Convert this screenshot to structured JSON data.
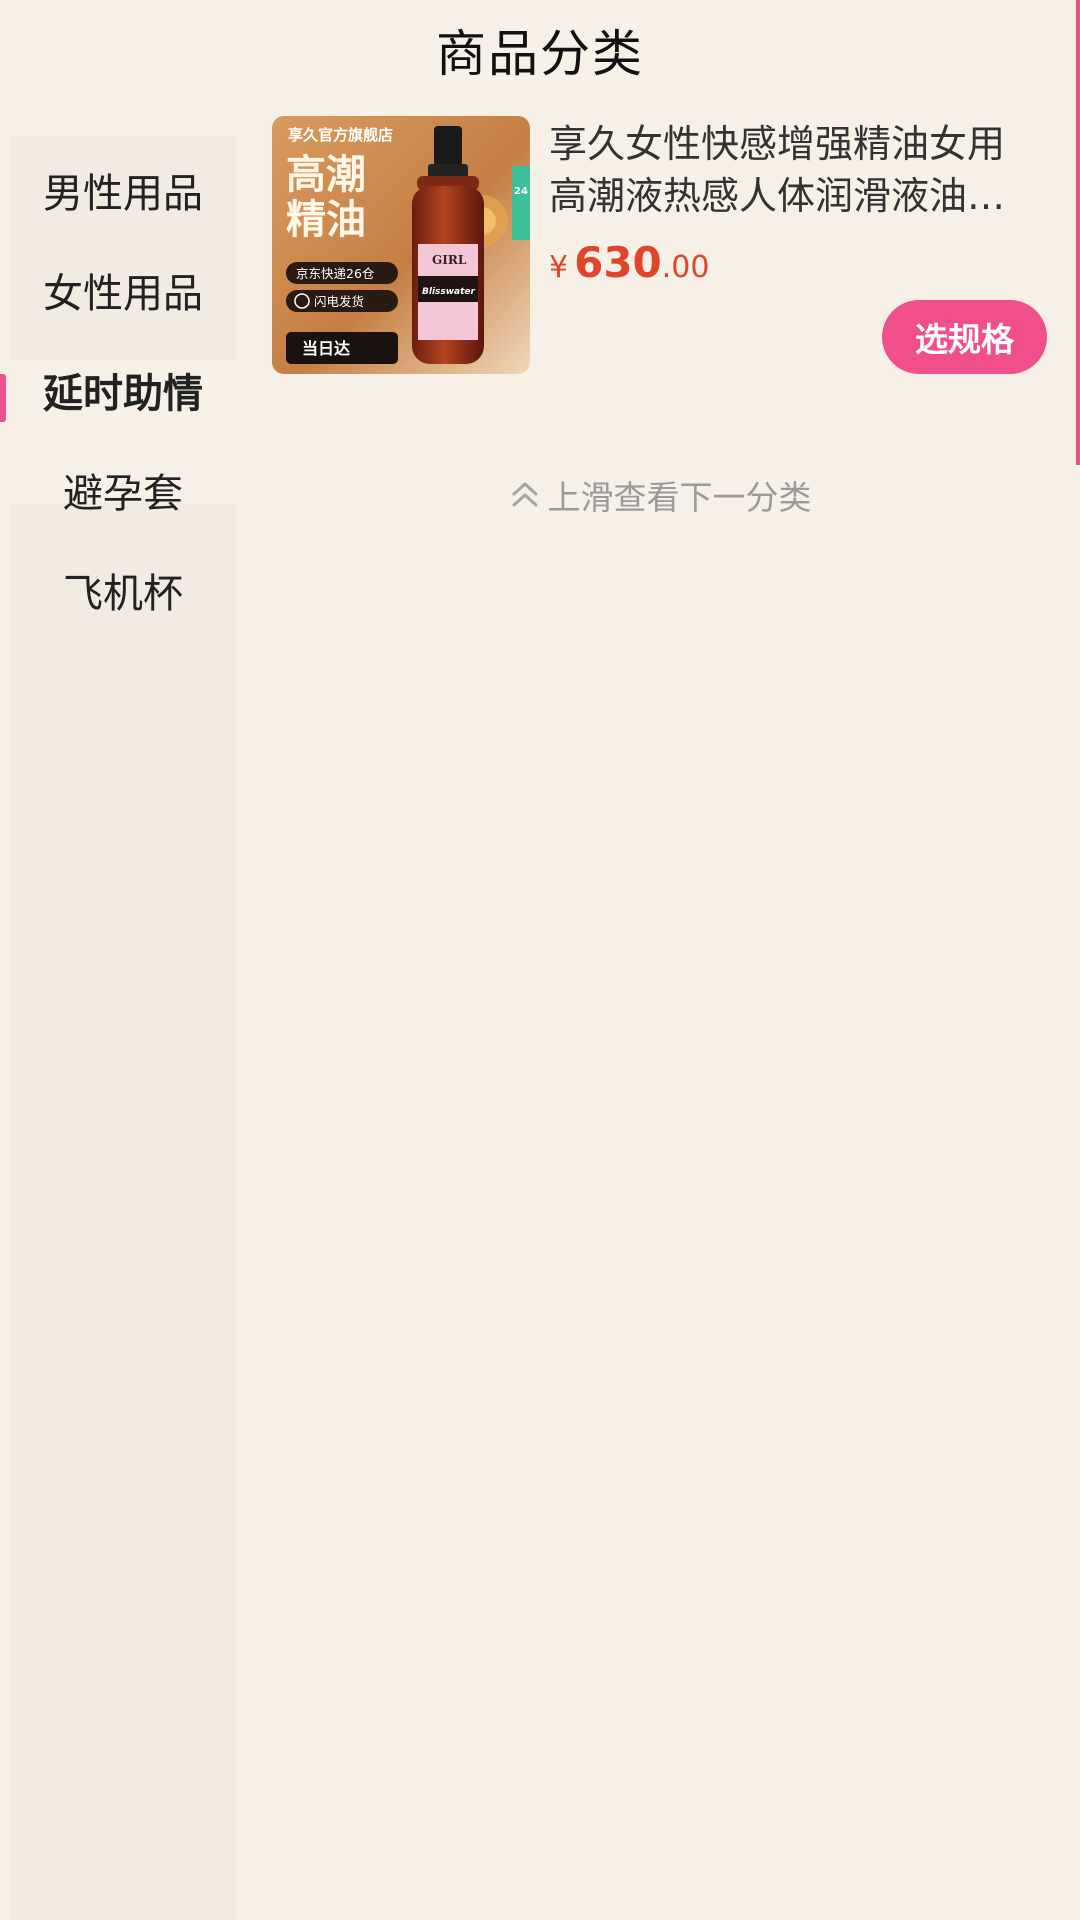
{
  "header": {
    "title": "商品分类"
  },
  "sidebar": {
    "items": [
      {
        "label": "男性用品",
        "active": false
      },
      {
        "label": "女性用品",
        "active": false
      },
      {
        "label": "延时助情",
        "active": true
      },
      {
        "label": "避孕套",
        "active": false
      },
      {
        "label": "飞机杯",
        "active": false
      }
    ]
  },
  "product": {
    "title": "享久女性快感增强精油女用高潮液热感人体润滑液油用品",
    "price_currency": "¥",
    "price_integer": "630",
    "price_decimal": ".00",
    "button_label": "选规格",
    "image": {
      "store_label": "享久官方旗舰店",
      "headline_1": "高潮",
      "headline_2": "精油",
      "badge_delivery": "京东快递26仓",
      "badge_flash": "闪电发货",
      "badge_sameday": "当日达",
      "badge_24h": "24",
      "bottle_brand": "GIRL",
      "bottle_name": "Blisswater"
    }
  },
  "next_category_hint": "上滑查看下一分类",
  "colors": {
    "accent": "#f04f8b",
    "price": "#e0452c",
    "background": "#f7f0e6"
  }
}
